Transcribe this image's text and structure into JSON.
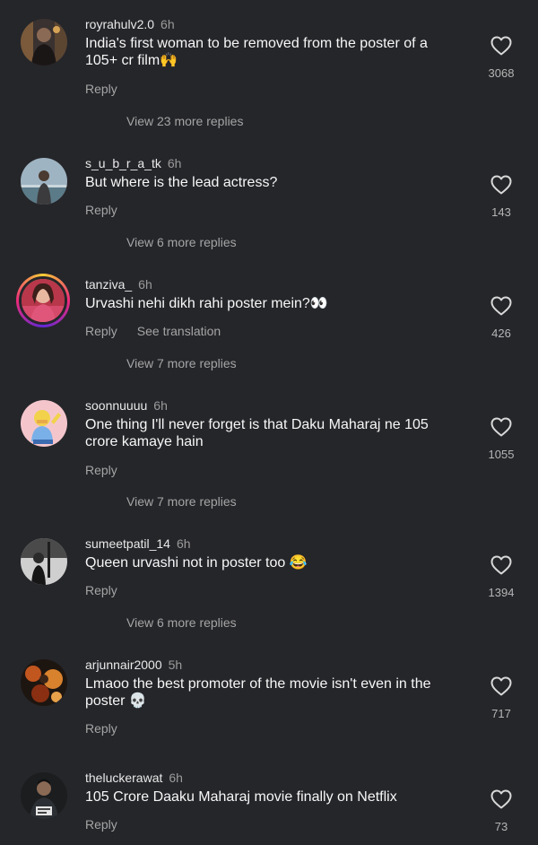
{
  "comments": [
    {
      "username": "royrahulv2.0",
      "time": "6h",
      "text": "India's first woman to be removed from the poster of a 105+ cr film🙌",
      "reply_label": "Reply",
      "likes": "3068",
      "view_more": "View 23 more replies"
    },
    {
      "username": "s_u_b_r_a_tk",
      "time": "6h",
      "text": "But where is the lead actress?",
      "reply_label": "Reply",
      "likes": "143",
      "view_more": "View 6 more replies"
    },
    {
      "username": "tanziva_",
      "time": "6h",
      "text": "Urvashi nehi dikh rahi poster mein?👀",
      "reply_label": "Reply",
      "translate_label": "See translation",
      "likes": "426",
      "view_more": "View 7 more replies"
    },
    {
      "username": "soonnuuuu",
      "time": "6h",
      "text": "One thing I'll never forget is that Daku Maharaj ne 105 crore kamaye hain",
      "reply_label": "Reply",
      "likes": "1055",
      "view_more": "View 7 more replies"
    },
    {
      "username": "sumeetpatil_14",
      "time": "6h",
      "text": "Queen urvashi not in poster too 😂",
      "reply_label": "Reply",
      "likes": "1394",
      "view_more": "View 6 more replies"
    },
    {
      "username": "arjunnair2000",
      "time": "5h",
      "text": "Lmaoo the best promoter of the movie isn't even in the poster 💀",
      "reply_label": "Reply",
      "likes": "717"
    },
    {
      "username": "theluckerawat",
      "time": "6h",
      "text": "105 Crore Daaku Maharaj movie finally on Netflix",
      "reply_label": "Reply",
      "likes": "73"
    }
  ],
  "colors": {
    "background": "#25262a",
    "text": "#f7f7f7",
    "secondary": "#a5a5a5"
  },
  "icons": {
    "like": "heart-outline-icon"
  }
}
